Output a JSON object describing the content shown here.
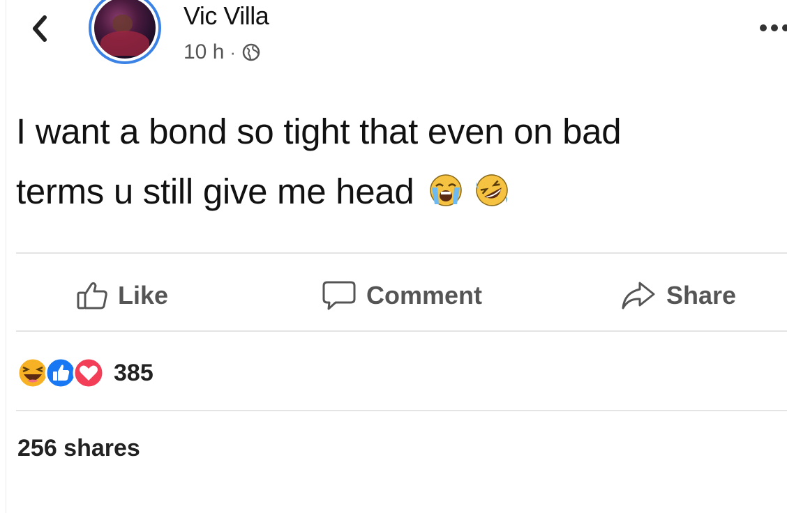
{
  "post": {
    "author": "Vic Villa",
    "time": "10 h",
    "separator": "·",
    "text_line1": "I want a bond so tight that even on bad",
    "text_line2": "terms u still give me head"
  },
  "actions": {
    "like": "Like",
    "comment": "Comment",
    "share": "Share"
  },
  "stats": {
    "reaction_count": "385",
    "shares": "256 shares"
  },
  "icons": {
    "back": "chevron-left-icon",
    "privacy": "globe-icon",
    "more": "more-options-icon",
    "emoji1": "loudly-crying-face",
    "emoji2": "rolling-on-floor-laughing",
    "reactions": [
      "haha-reaction",
      "like-reaction",
      "love-reaction"
    ]
  },
  "colors": {
    "avatar_ring": "#3b82e6",
    "like_blue": "#1877f2",
    "love_red": "#f33e58",
    "haha_yellow": "#f7b125"
  }
}
